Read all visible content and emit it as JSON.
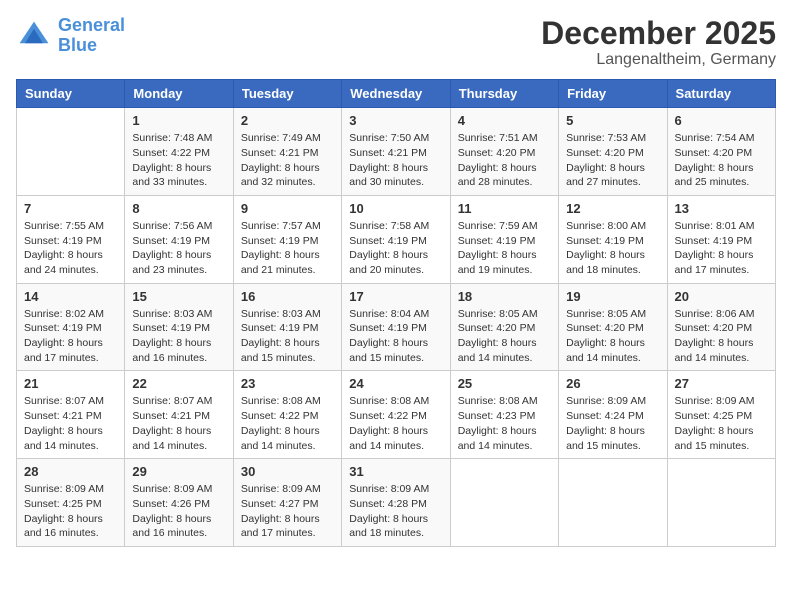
{
  "logo": {
    "line1": "General",
    "line2": "Blue"
  },
  "title": "December 2025",
  "location": "Langenaltheim, Germany",
  "days_header": [
    "Sunday",
    "Monday",
    "Tuesday",
    "Wednesday",
    "Thursday",
    "Friday",
    "Saturday"
  ],
  "weeks": [
    [
      {
        "day": "",
        "info": ""
      },
      {
        "day": "1",
        "info": "Sunrise: 7:48 AM\nSunset: 4:22 PM\nDaylight: 8 hours\nand 33 minutes."
      },
      {
        "day": "2",
        "info": "Sunrise: 7:49 AM\nSunset: 4:21 PM\nDaylight: 8 hours\nand 32 minutes."
      },
      {
        "day": "3",
        "info": "Sunrise: 7:50 AM\nSunset: 4:21 PM\nDaylight: 8 hours\nand 30 minutes."
      },
      {
        "day": "4",
        "info": "Sunrise: 7:51 AM\nSunset: 4:20 PM\nDaylight: 8 hours\nand 28 minutes."
      },
      {
        "day": "5",
        "info": "Sunrise: 7:53 AM\nSunset: 4:20 PM\nDaylight: 8 hours\nand 27 minutes."
      },
      {
        "day": "6",
        "info": "Sunrise: 7:54 AM\nSunset: 4:20 PM\nDaylight: 8 hours\nand 25 minutes."
      }
    ],
    [
      {
        "day": "7",
        "info": "Sunrise: 7:55 AM\nSunset: 4:19 PM\nDaylight: 8 hours\nand 24 minutes."
      },
      {
        "day": "8",
        "info": "Sunrise: 7:56 AM\nSunset: 4:19 PM\nDaylight: 8 hours\nand 23 minutes."
      },
      {
        "day": "9",
        "info": "Sunrise: 7:57 AM\nSunset: 4:19 PM\nDaylight: 8 hours\nand 21 minutes."
      },
      {
        "day": "10",
        "info": "Sunrise: 7:58 AM\nSunset: 4:19 PM\nDaylight: 8 hours\nand 20 minutes."
      },
      {
        "day": "11",
        "info": "Sunrise: 7:59 AM\nSunset: 4:19 PM\nDaylight: 8 hours\nand 19 minutes."
      },
      {
        "day": "12",
        "info": "Sunrise: 8:00 AM\nSunset: 4:19 PM\nDaylight: 8 hours\nand 18 minutes."
      },
      {
        "day": "13",
        "info": "Sunrise: 8:01 AM\nSunset: 4:19 PM\nDaylight: 8 hours\nand 17 minutes."
      }
    ],
    [
      {
        "day": "14",
        "info": "Sunrise: 8:02 AM\nSunset: 4:19 PM\nDaylight: 8 hours\nand 17 minutes."
      },
      {
        "day": "15",
        "info": "Sunrise: 8:03 AM\nSunset: 4:19 PM\nDaylight: 8 hours\nand 16 minutes."
      },
      {
        "day": "16",
        "info": "Sunrise: 8:03 AM\nSunset: 4:19 PM\nDaylight: 8 hours\nand 15 minutes."
      },
      {
        "day": "17",
        "info": "Sunrise: 8:04 AM\nSunset: 4:19 PM\nDaylight: 8 hours\nand 15 minutes."
      },
      {
        "day": "18",
        "info": "Sunrise: 8:05 AM\nSunset: 4:20 PM\nDaylight: 8 hours\nand 14 minutes."
      },
      {
        "day": "19",
        "info": "Sunrise: 8:05 AM\nSunset: 4:20 PM\nDaylight: 8 hours\nand 14 minutes."
      },
      {
        "day": "20",
        "info": "Sunrise: 8:06 AM\nSunset: 4:20 PM\nDaylight: 8 hours\nand 14 minutes."
      }
    ],
    [
      {
        "day": "21",
        "info": "Sunrise: 8:07 AM\nSunset: 4:21 PM\nDaylight: 8 hours\nand 14 minutes."
      },
      {
        "day": "22",
        "info": "Sunrise: 8:07 AM\nSunset: 4:21 PM\nDaylight: 8 hours\nand 14 minutes."
      },
      {
        "day": "23",
        "info": "Sunrise: 8:08 AM\nSunset: 4:22 PM\nDaylight: 8 hours\nand 14 minutes."
      },
      {
        "day": "24",
        "info": "Sunrise: 8:08 AM\nSunset: 4:22 PM\nDaylight: 8 hours\nand 14 minutes."
      },
      {
        "day": "25",
        "info": "Sunrise: 8:08 AM\nSunset: 4:23 PM\nDaylight: 8 hours\nand 14 minutes."
      },
      {
        "day": "26",
        "info": "Sunrise: 8:09 AM\nSunset: 4:24 PM\nDaylight: 8 hours\nand 15 minutes."
      },
      {
        "day": "27",
        "info": "Sunrise: 8:09 AM\nSunset: 4:25 PM\nDaylight: 8 hours\nand 15 minutes."
      }
    ],
    [
      {
        "day": "28",
        "info": "Sunrise: 8:09 AM\nSunset: 4:25 PM\nDaylight: 8 hours\nand 16 minutes."
      },
      {
        "day": "29",
        "info": "Sunrise: 8:09 AM\nSunset: 4:26 PM\nDaylight: 8 hours\nand 16 minutes."
      },
      {
        "day": "30",
        "info": "Sunrise: 8:09 AM\nSunset: 4:27 PM\nDaylight: 8 hours\nand 17 minutes."
      },
      {
        "day": "31",
        "info": "Sunrise: 8:09 AM\nSunset: 4:28 PM\nDaylight: 8 hours\nand 18 minutes."
      },
      {
        "day": "",
        "info": ""
      },
      {
        "day": "",
        "info": ""
      },
      {
        "day": "",
        "info": ""
      }
    ]
  ]
}
